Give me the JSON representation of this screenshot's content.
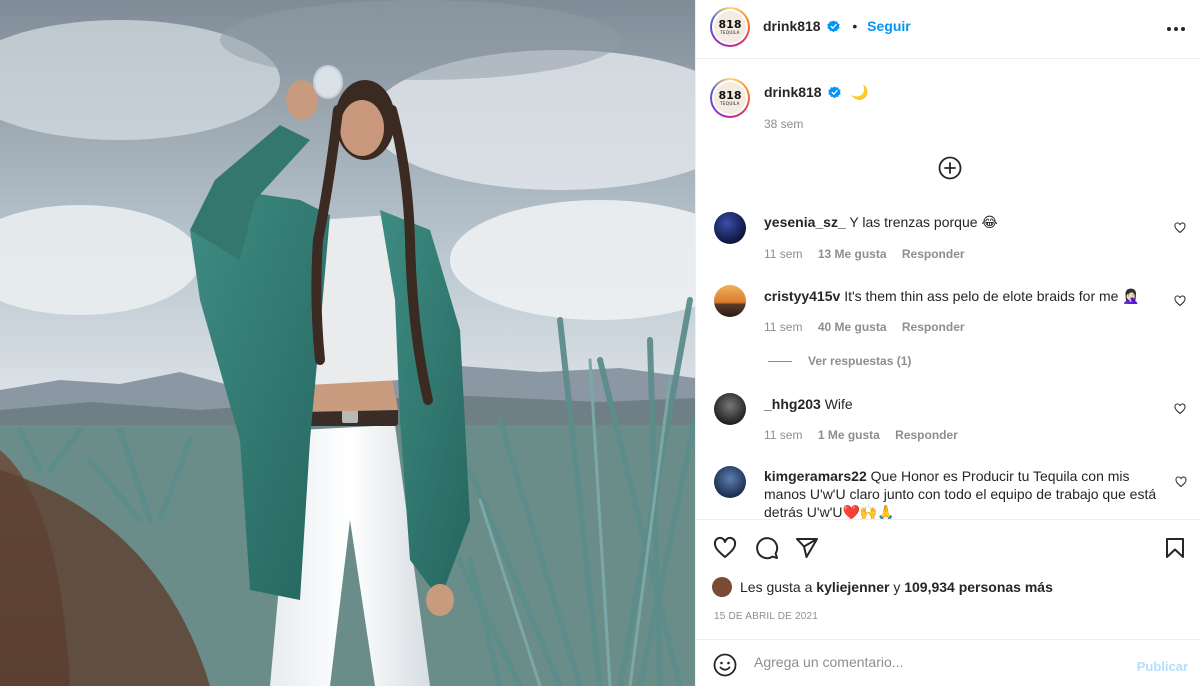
{
  "post": {
    "image_alt": "Woman in teal shirt and white jeans drinking from a glass in an agave field"
  },
  "header": {
    "username": "drink818",
    "avatar_text": "818",
    "avatar_subtext": "TEQUILA",
    "separator": "•",
    "follow_label": "Seguir",
    "more_icon": "more-horizontal-icon"
  },
  "caption": {
    "username": "drink818",
    "text": "🌙",
    "time": "38 sem"
  },
  "load_more_icon": "plus-circle-icon",
  "comments": [
    {
      "username": "yesenia_sz_",
      "text": "Y las trenzas porque 😂",
      "time": "11 sem",
      "likes": "13 Me gusta",
      "reply": "Responder"
    },
    {
      "username": "cristyy415v",
      "text": "It's them thin ass pelo de elote braids for me 🤦🏻‍♀️",
      "time": "11 sem",
      "likes": "40 Me gusta",
      "reply": "Responder",
      "view_replies": "Ver respuestas (1)"
    },
    {
      "username": "_hhg203",
      "text": "Wife",
      "time": "11 sem",
      "likes": "1 Me gusta",
      "reply": "Responder"
    },
    {
      "username": "kimgeramars22",
      "text": "Que Honor es Producir tu Tequila con mis manos U'w'U claro junto con todo el equipo de trabajo que está detrás U'w'U❤️🙌🙏"
    }
  ],
  "likes": {
    "prefix": "Les gusta a",
    "user": "kyliejenner",
    "connector": "y",
    "others": "109,934 personas más"
  },
  "date": "15 DE ABRIL DE 2021",
  "add_comment": {
    "placeholder": "Agrega un comentario...",
    "publish_label": "Publicar"
  },
  "colors": {
    "accent": "#0095f6",
    "publish_disabled": "#b2dffc",
    "muted": "#8e8e8e",
    "text": "#262626"
  }
}
